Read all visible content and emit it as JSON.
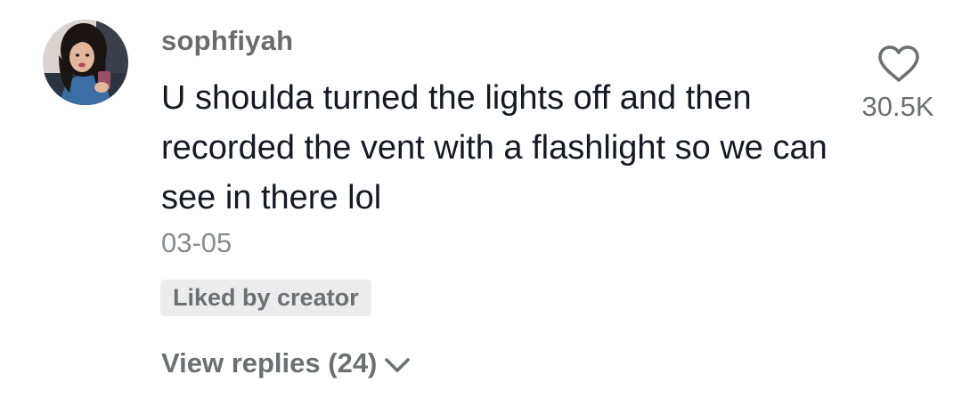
{
  "comment": {
    "author": {
      "username": "sophfiyah",
      "avatar": "profile-photo"
    },
    "text": "U shoulda turned the lights off and then recorded the vent with a flashlight so we can see in there lol",
    "date": "03-05",
    "liked_by_creator_label": "Liked by creator",
    "view_replies_label": "View replies (24)",
    "like": {
      "icon": "heart-outline-icon",
      "count": "30.5K"
    }
  },
  "colors": {
    "primary_text": "#161823",
    "secondary_text": "#6e6f73",
    "date_text": "#8a8b91",
    "badge_background": "#ececec",
    "background": "#ffffff"
  }
}
